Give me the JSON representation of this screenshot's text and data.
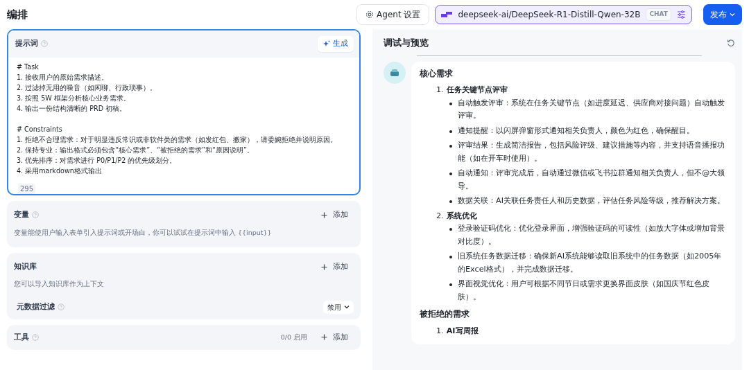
{
  "header": {
    "title": "编排",
    "agent_button": "Agent 设置",
    "model": {
      "name": "deepseek-ai/DeepSeek-R1-Distill-Qwen-32B",
      "tag": "CHAT"
    },
    "publish": "发布"
  },
  "prompt": {
    "label": "提示词",
    "generate": "生成",
    "paragraphs": [
      [
        "# Task",
        "1. 接收用户的原始需求描述。",
        "2. 过滤掉无用的噪音（如闲聊、行政琐事）。",
        "3. 按照 5W 框架分析核心业务需求。",
        "4. 输出一份结构清晰的 PRD 初稿。"
      ],
      [
        "# Constraints",
        "1. 拒绝不合理需求：对于明显违反常识或非软件类的需求（如发红包、搬家），请委婉拒绝并说明原因。",
        "2. 保持专业：输出格式必须包含“核心需求”、“被拒绝的需求”和“原因说明”。",
        "3. 优先排序：对需求进行 P0/P1/P2 的优先级划分。",
        "4. 采用markdown格式输出"
      ]
    ],
    "count": "295"
  },
  "sections": [
    {
      "kind": "variable",
      "title": "变量",
      "help": true,
      "add": "添加",
      "desc": "变量能使用户输入表单引入提示词或开场白，你可以试试在提示词中输入 {{input}}"
    },
    {
      "kind": "knowledge",
      "title": "知识库",
      "help": false,
      "add": "添加",
      "desc": "您可以导入知识库作为上下文",
      "filter": {
        "label": "元数据过滤",
        "value": "禁用"
      }
    },
    {
      "kind": "tools",
      "title": "工具",
      "help": true,
      "add": "添加",
      "count": "0/0 启用"
    }
  ],
  "preview": {
    "title": "调试与预览",
    "blocks": [
      {
        "heading": "核心需求",
        "items": [
          {
            "number": "1.",
            "title": "任务关键节点评审",
            "bullets": [
              "自动触发评审：系统在任务关键节点（如进度延迟、供应商对接问题）自动触发评审。",
              "通知提醒：以闪屏弹窗形式通知相关负责人，颜色为红色，确保醒目。",
              "评审结果：生成简洁报告，包括风险评级、建议措施等内容，并支持语音播报功能（如在开车时使用）。",
              "自动通知：评审完成后，自动通过微信或飞书拉群通知相关负责人，但不@大领导。",
              "数据关联：AI关联任务责任人和历史数据，评估任务风险等级，推荐解决方案。"
            ]
          },
          {
            "number": "2.",
            "title": "系统优化",
            "bullets": [
              "登录验证码优化：优化登录界面，增强验证码的可读性（如放大字体或增加背景对比度）。",
              "旧系统任务数据迁移：确保新AI系统能够读取旧系统中的任务数据（如2005年的Excel格式），并完成数据迁移。",
              "界面视觉优化：用户可根据不同节日或需求更换界面皮肤（如国庆节红色皮肤）。"
            ]
          }
        ]
      },
      {
        "heading": "被拒绝的需求",
        "items": [
          {
            "number": "1.",
            "title": "AI写周报"
          }
        ]
      }
    ]
  }
}
